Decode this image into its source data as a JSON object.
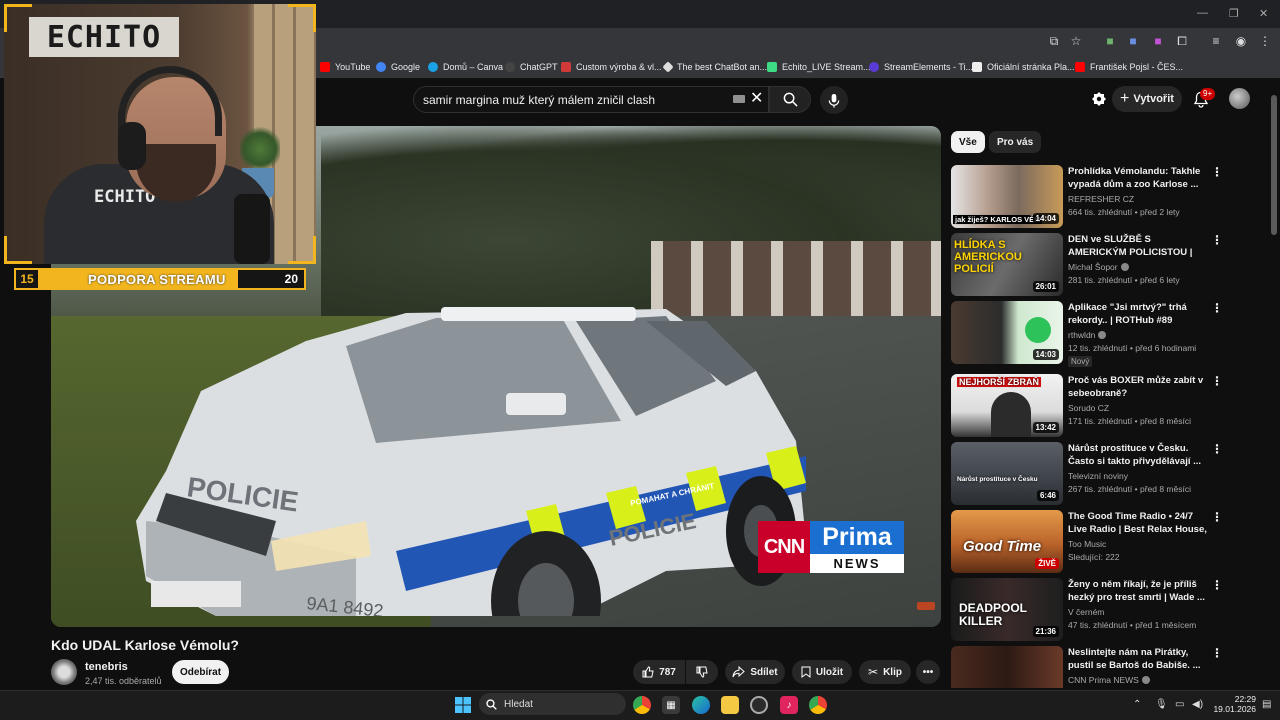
{
  "bookmarks": [
    {
      "label": "YouTube",
      "color": "#ff0000"
    },
    {
      "label": "Google",
      "color": "#4285f4"
    },
    {
      "label": "Domů – Canva",
      "color": "#1ba1e6"
    },
    {
      "label": "ChatGPT",
      "color": "#444444"
    },
    {
      "label": "Custom výroba & vl...",
      "color": "#d23a3a"
    },
    {
      "label": "The best ChatBot an...",
      "color": "#dddddd"
    },
    {
      "label": "Echito_LIVE Stream...",
      "color": "#3ddc84"
    },
    {
      "label": "StreamElements - Ti...",
      "color": "#5b3bd6"
    },
    {
      "label": "Oficiální stránka Pla...",
      "color": "#eeeeee"
    },
    {
      "label": "František Pojsl - ČES...",
      "color": "#ff0000"
    }
  ],
  "search": {
    "query": "samir margina muž který málem zničil clash"
  },
  "header": {
    "create_label": "Vytvořit",
    "notif_count": "9+"
  },
  "overlay": {
    "sign_text": "ECHITO",
    "shirt_text": "ECHITO",
    "support": {
      "left": "15",
      "label": "PODPORA STREAMU",
      "right": "20",
      "progress": 0.75
    },
    "accent": "#f2b51d"
  },
  "video": {
    "logo_cnn": "CNN",
    "logo_prima": "Prima",
    "logo_news": "NEWS",
    "car_text_main": "POLICIE",
    "car_text_door": "POLICIE",
    "car_stripe_text": "POMAHAT A CHRÁNIT",
    "plate": "9A1 8492"
  },
  "watch": {
    "title": "Kdo UDAL Karlose Vémolu?",
    "channel": "tenebris",
    "subscribers": "2,47 tis. odběratelů",
    "subscribe_label": "Odebírat",
    "likes": "787",
    "share_label": "Sdílet",
    "save_label": "Uložit",
    "clip_label": "Klip"
  },
  "chips": [
    {
      "label": "Vše"
    },
    {
      "label": "Pro vás"
    }
  ],
  "recommendations": [
    {
      "title": "Prohlídka Vémolandu: Takhle vypadá dům a zoo Karlose ...",
      "channel": "REFRESHER CZ",
      "meta": "664 tis. zhlédnutí • před 2 lety",
      "duration": "14:04",
      "thumb_caption": "jak žiješ? KARLOS VĚM"
    },
    {
      "title": "DEN ve SLUŽBĚ S AMERICKÝM POLICISTOU | Hlídkujeme v ...",
      "channel": "Michal Šopor",
      "meta": "281 tis. zhlédnutí • před 6 lety",
      "duration": "26:01",
      "thumb_caption": "HLÍDKA S AMERICKOU POLICIÍ"
    },
    {
      "title": "Aplikace \"Jsi mrtvý?\" trhá rekordy.. | ROTHub #89",
      "channel": "rthwldn",
      "meta": "12 tis. zhlédnutí • před 6 hodinami",
      "duration": "14:03",
      "tag": "Nový"
    },
    {
      "title": "Proč vás BOXER může zabít v sebeobraně?",
      "channel": "Sorudo CZ",
      "meta": "171 tis. zhlédnutí • před 8 měsíci",
      "duration": "13:42",
      "thumb_caption": "NEJHORŠÍ ZBRAŇ"
    },
    {
      "title": "Nárůst prostituce v Česku. Často si takto přivydělávají ...",
      "channel": "Televizní noviny",
      "meta": "267 tis. zhlédnutí • před 8 měsíci",
      "duration": "6:46",
      "thumb_caption": "Nárůst prostituce v Česku"
    },
    {
      "title": "The Good Time Radio • 24/7 Live Radio | Best Relax House, ...",
      "channel": "Too Music",
      "meta": "Sledující: 222",
      "live": "ŽIVĚ",
      "thumb_caption": "Good Time"
    },
    {
      "title": "Ženy o něm říkají, že je příliš hezký pro trest smrti | Wade ...",
      "channel": "V černém",
      "meta": "47 tis. zhlédnutí • před 1 měsícem",
      "duration": "21:36",
      "thumb_caption": "DEADPOOL KILLER"
    },
    {
      "title": "Neslintejte nám na Pirátky, pustil se Bartoš do Babiše. ...",
      "channel": "CNN Prima NEWS",
      "meta": "",
      "duration": ""
    }
  ],
  "taskbar": {
    "search_label": "Hledat",
    "time": "22:29",
    "date": "19.01.2026"
  }
}
